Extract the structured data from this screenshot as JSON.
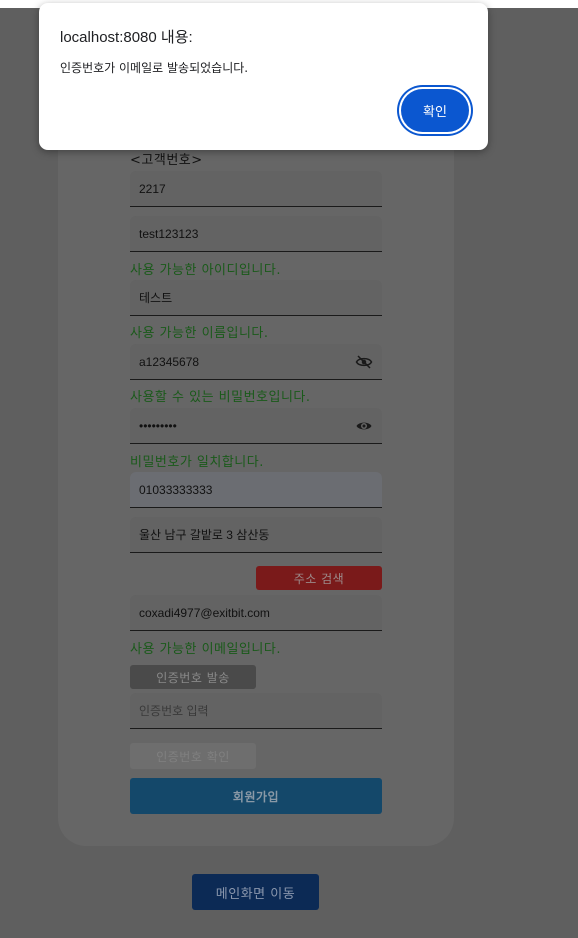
{
  "dialog": {
    "title": "localhost:8080 내용:",
    "message": "인증번호가 이메일로 발송되었습니다.",
    "ok_label": "확인"
  },
  "form": {
    "customer_no_label": "<고객번호>",
    "customer_no": "2217",
    "user_id": "test123123",
    "user_id_msg": "사용 가능한 아이디입니다.",
    "name": "테스트",
    "name_msg": "사용 가능한 이름입니다.",
    "password": "a12345678",
    "password_msg": "사용할 수 있는 비밀번호입니다.",
    "password_confirm": "•••••••••",
    "password_confirm_msg": "비밀번호가 일치합니다.",
    "phone": "01033333333",
    "address": "울산 남구 갈밭로 3 삼산동",
    "address_search_label": "주소 검색",
    "email": "coxadi4977@exitbit.com",
    "email_msg": "사용 가능한 이메일입니다.",
    "send_code_label": "인증번호 발송",
    "code_placeholder": "인증번호 입력",
    "verify_code_label": "인증번호 확인",
    "join_label": "회원가입"
  },
  "main_button_label": "메인화면 이동",
  "colors": {
    "overlay": "#5f5f5f",
    "success_text": "#1a5a1a",
    "dialog_button": "#0b57d0"
  },
  "icons": {
    "password_toggle_hidden": "eye-slash-icon",
    "password_toggle_visible": "eye-icon"
  }
}
